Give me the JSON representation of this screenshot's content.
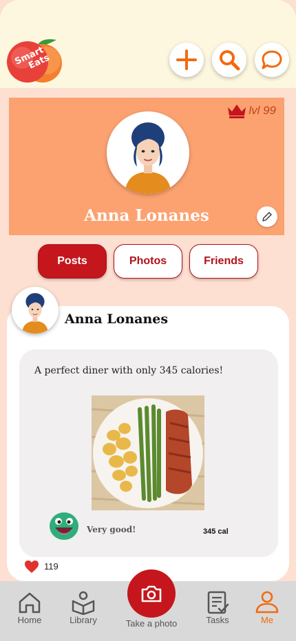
{
  "app": {
    "logo_text_1": "Smart",
    "logo_text_2": "Eats",
    "brand_orange": "#f26a0f",
    "brand_red": "#c4161c"
  },
  "header": {
    "add_icon": "plus-icon",
    "search_icon": "search-icon",
    "chat_icon": "chat-bubble-icon"
  },
  "profile": {
    "name": "Anna Lonanes",
    "level": "lvl 99",
    "level_icon": "crown-icon",
    "edit_icon": "pencil-icon"
  },
  "tabs": [
    {
      "label": "Posts",
      "active": true
    },
    {
      "label": "Photos",
      "active": false
    },
    {
      "label": "Friends",
      "active": false
    }
  ],
  "post": {
    "author": "Anna Lonanes",
    "text": "A perfect diner with only 345 calories!",
    "rating_label": "Very good!",
    "calories": "345 cal",
    "likes": "119"
  },
  "bottom_nav": {
    "items": [
      {
        "label": "Home",
        "icon": "home-icon"
      },
      {
        "label": "Library",
        "icon": "book-icon"
      },
      {
        "label": "Take a photo",
        "icon": "camera-icon"
      },
      {
        "label": "Tasks",
        "icon": "checklist-icon"
      },
      {
        "label": "Me",
        "icon": "user-icon",
        "active": true
      }
    ]
  }
}
